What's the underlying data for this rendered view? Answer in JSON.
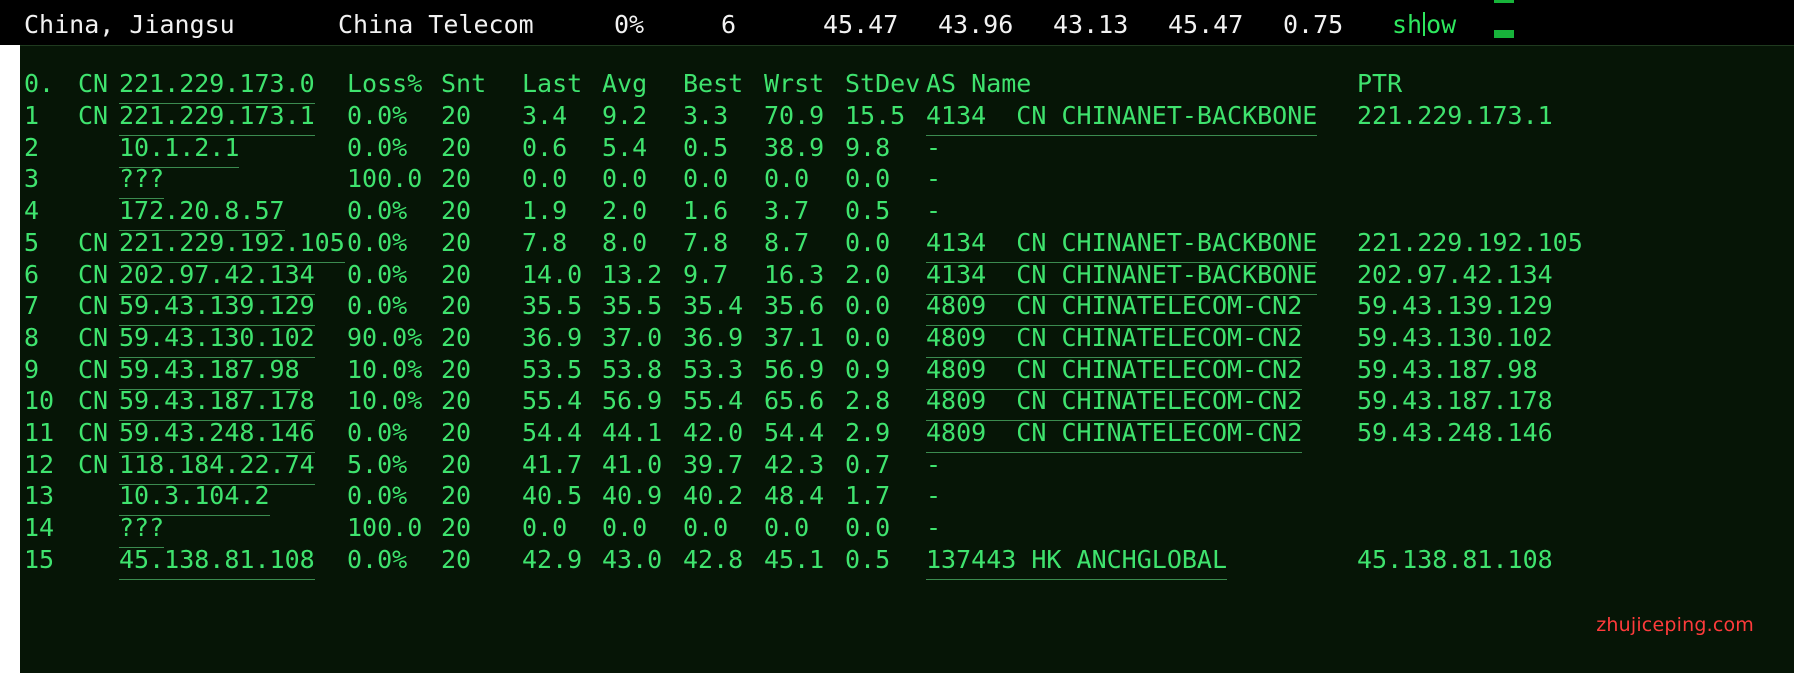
{
  "summary": {
    "region": "China, Jiangsu",
    "isp": "China Telecom",
    "loss": "0%",
    "hops": "6",
    "v1": "45.47",
    "v2": "43.96",
    "v3": "43.13",
    "v4": "45.47",
    "v5": "0.75",
    "show_pre": "sh",
    "show_post": "ow"
  },
  "table": {
    "header": {
      "hop": "0.",
      "cc": "CN",
      "host": "221.229.173.0",
      "loss": "Loss%",
      "snt": "Snt",
      "last": "Last",
      "avg": "Avg",
      "best": "Best",
      "wrst": "Wrst",
      "stdev": "StDev",
      "asname": "AS Name",
      "ptr": "PTR"
    },
    "rows": [
      {
        "hop": "1",
        "cc": "CN",
        "host": "221.229.173.1",
        "loss": "0.0%",
        "snt": "20",
        "last": "3.4",
        "avg": "9.2",
        "best": "3.3",
        "wrst": "70.9",
        "stdev": "15.5",
        "asname": "4134  CN CHINANET-BACKBONE",
        "ptr": "221.229.173.1"
      },
      {
        "hop": "2",
        "cc": "",
        "host": "10.1.2.1",
        "loss": "0.0%",
        "snt": "20",
        "last": "0.6",
        "avg": "5.4",
        "best": "0.5",
        "wrst": "38.9",
        "stdev": "9.8",
        "asname": "-",
        "ptr": ""
      },
      {
        "hop": "3",
        "cc": "",
        "host": "???",
        "loss": "100.0",
        "snt": "20",
        "last": "0.0",
        "avg": "0.0",
        "best": "0.0",
        "wrst": "0.0",
        "stdev": "0.0",
        "asname": "-",
        "ptr": ""
      },
      {
        "hop": "4",
        "cc": "",
        "host": "172.20.8.57",
        "loss": "0.0%",
        "snt": "20",
        "last": "1.9",
        "avg": "2.0",
        "best": "1.6",
        "wrst": "3.7",
        "stdev": "0.5",
        "asname": "-",
        "ptr": ""
      },
      {
        "hop": "5",
        "cc": "CN",
        "host": "221.229.192.105",
        "loss": "0.0%",
        "snt": "20",
        "last": "7.8",
        "avg": "8.0",
        "best": "7.8",
        "wrst": "8.7",
        "stdev": "0.0",
        "asname": "4134  CN CHINANET-BACKBONE",
        "ptr": "221.229.192.105"
      },
      {
        "hop": "6",
        "cc": "CN",
        "host": "202.97.42.134",
        "loss": "0.0%",
        "snt": "20",
        "last": "14.0",
        "avg": "13.2",
        "best": "9.7",
        "wrst": "16.3",
        "stdev": "2.0",
        "asname": "4134  CN CHINANET-BACKBONE",
        "ptr": "202.97.42.134"
      },
      {
        "hop": "7",
        "cc": "CN",
        "host": "59.43.139.129",
        "loss": "0.0%",
        "snt": "20",
        "last": "35.5",
        "avg": "35.5",
        "best": "35.4",
        "wrst": "35.6",
        "stdev": "0.0",
        "asname": "4809  CN CHINATELECOM-CN2",
        "ptr": "59.43.139.129"
      },
      {
        "hop": "8",
        "cc": "CN",
        "host": "59.43.130.102",
        "loss": "90.0%",
        "snt": "20",
        "last": "36.9",
        "avg": "37.0",
        "best": "36.9",
        "wrst": "37.1",
        "stdev": "0.0",
        "asname": "4809  CN CHINATELECOM-CN2",
        "ptr": "59.43.130.102"
      },
      {
        "hop": "9",
        "cc": "CN",
        "host": "59.43.187.98",
        "loss": "10.0%",
        "snt": "20",
        "last": "53.5",
        "avg": "53.8",
        "best": "53.3",
        "wrst": "56.9",
        "stdev": "0.9",
        "asname": "4809  CN CHINATELECOM-CN2",
        "ptr": "59.43.187.98"
      },
      {
        "hop": "10",
        "cc": "CN",
        "host": "59.43.187.178",
        "loss": "10.0%",
        "snt": "20",
        "last": "55.4",
        "avg": "56.9",
        "best": "55.4",
        "wrst": "65.6",
        "stdev": "2.8",
        "asname": "4809  CN CHINATELECOM-CN2",
        "ptr": "59.43.187.178"
      },
      {
        "hop": "11",
        "cc": "CN",
        "host": "59.43.248.146",
        "loss": "0.0%",
        "snt": "20",
        "last": "54.4",
        "avg": "44.1",
        "best": "42.0",
        "wrst": "54.4",
        "stdev": "2.9",
        "asname": "4809  CN CHINATELECOM-CN2",
        "ptr": "59.43.248.146"
      },
      {
        "hop": "12",
        "cc": "CN",
        "host": "118.184.22.74",
        "loss": "5.0%",
        "snt": "20",
        "last": "41.7",
        "avg": "41.0",
        "best": "39.7",
        "wrst": "42.3",
        "stdev": "0.7",
        "asname": "-",
        "ptr": ""
      },
      {
        "hop": "13",
        "cc": "",
        "host": "10.3.104.2",
        "loss": "0.0%",
        "snt": "20",
        "last": "40.5",
        "avg": "40.9",
        "best": "40.2",
        "wrst": "48.4",
        "stdev": "1.7",
        "asname": "-",
        "ptr": ""
      },
      {
        "hop": "14",
        "cc": "",
        "host": "???",
        "loss": "100.0",
        "snt": "20",
        "last": "0.0",
        "avg": "0.0",
        "best": "0.0",
        "wrst": "0.0",
        "stdev": "0.0",
        "asname": "-",
        "ptr": ""
      },
      {
        "hop": "15",
        "cc": "",
        "host": "45.138.81.108",
        "loss": "0.0%",
        "snt": "20",
        "last": "42.9",
        "avg": "43.0",
        "best": "42.8",
        "wrst": "45.1",
        "stdev": "0.5",
        "asname": "137443 HK ANCHGLOBAL",
        "ptr": "45.138.81.108"
      }
    ]
  },
  "watermark": "zhujiceping.com",
  "colors": {
    "terminal_bg": "#061506",
    "terminal_text": "#3fe36e",
    "watermark": "#ff3b3b"
  }
}
